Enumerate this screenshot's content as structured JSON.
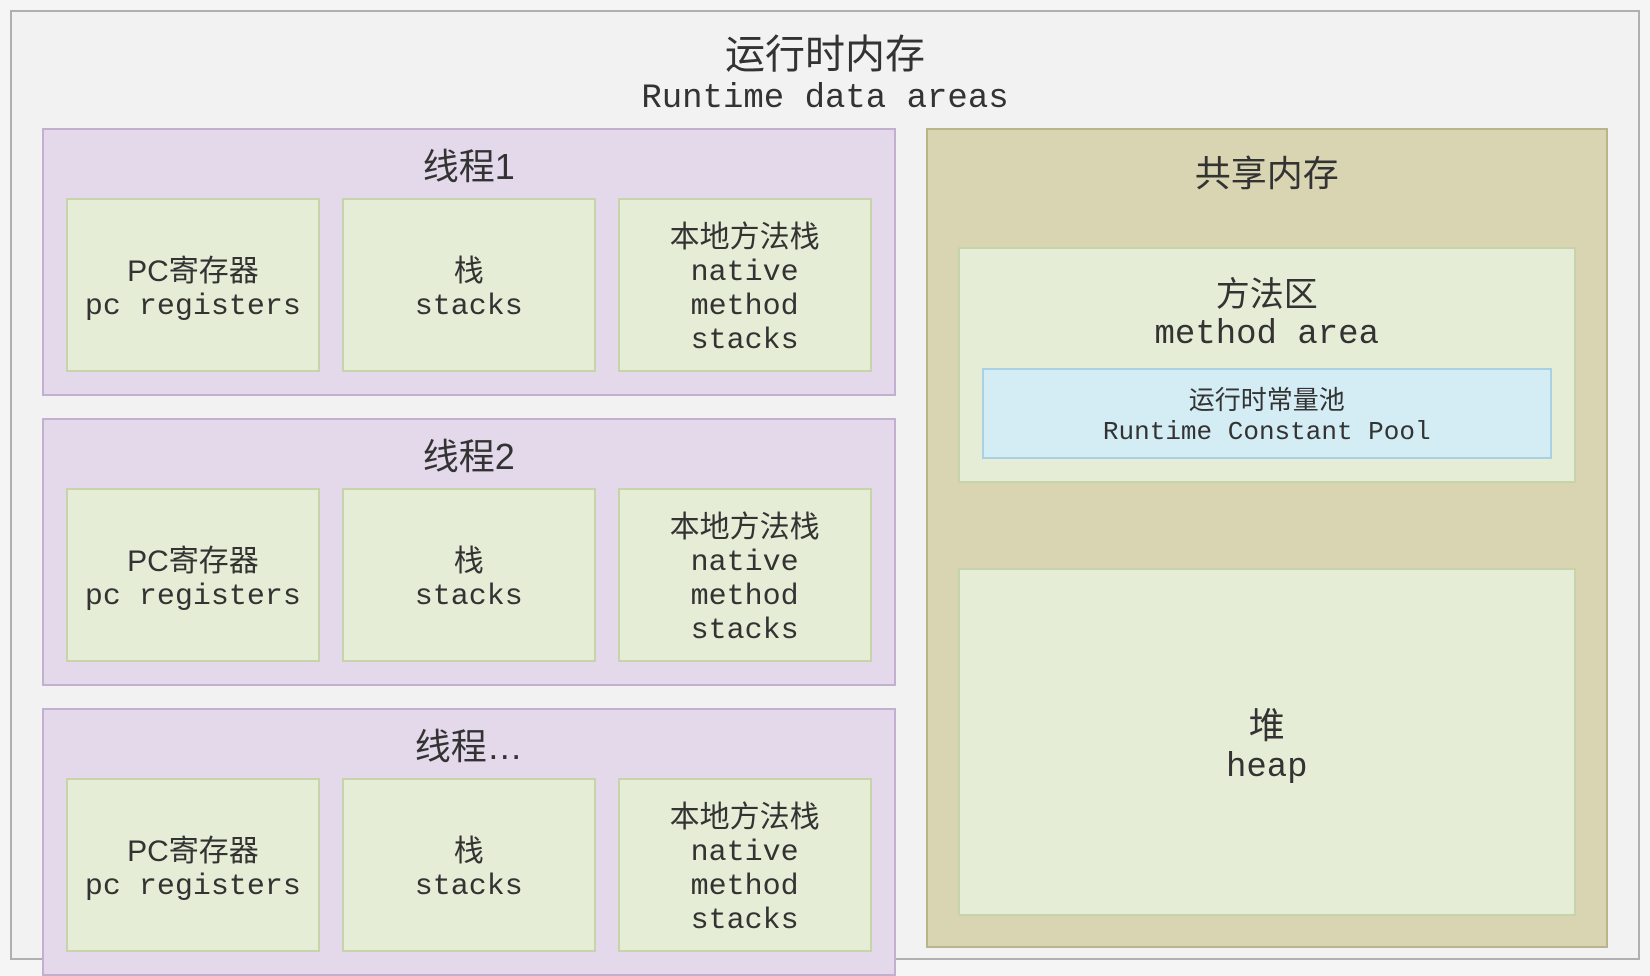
{
  "header": {
    "cn": "运行时内存",
    "en": "Runtime data areas"
  },
  "threads": [
    {
      "title": "线程1",
      "items": [
        {
          "cn": "PC寄存器",
          "en": "pc registers"
        },
        {
          "cn": "栈",
          "en": "stacks"
        },
        {
          "cn": "本地方法栈",
          "en": "native method stacks"
        }
      ]
    },
    {
      "title": "线程2",
      "items": [
        {
          "cn": "PC寄存器",
          "en": "pc registers"
        },
        {
          "cn": "栈",
          "en": "stacks"
        },
        {
          "cn": "本地方法栈",
          "en": "native method stacks"
        }
      ]
    },
    {
      "title": "线程…",
      "items": [
        {
          "cn": "PC寄存器",
          "en": "pc registers"
        },
        {
          "cn": "栈",
          "en": "stacks"
        },
        {
          "cn": "本地方法栈",
          "en": "native method stacks"
        }
      ]
    }
  ],
  "shared": {
    "title": "共享内存",
    "method_area": {
      "cn": "方法区",
      "en": "method area",
      "constant_pool": {
        "cn": "运行时常量池",
        "en": "Runtime Constant Pool"
      }
    },
    "heap": {
      "cn": "堆",
      "en": "heap"
    }
  }
}
